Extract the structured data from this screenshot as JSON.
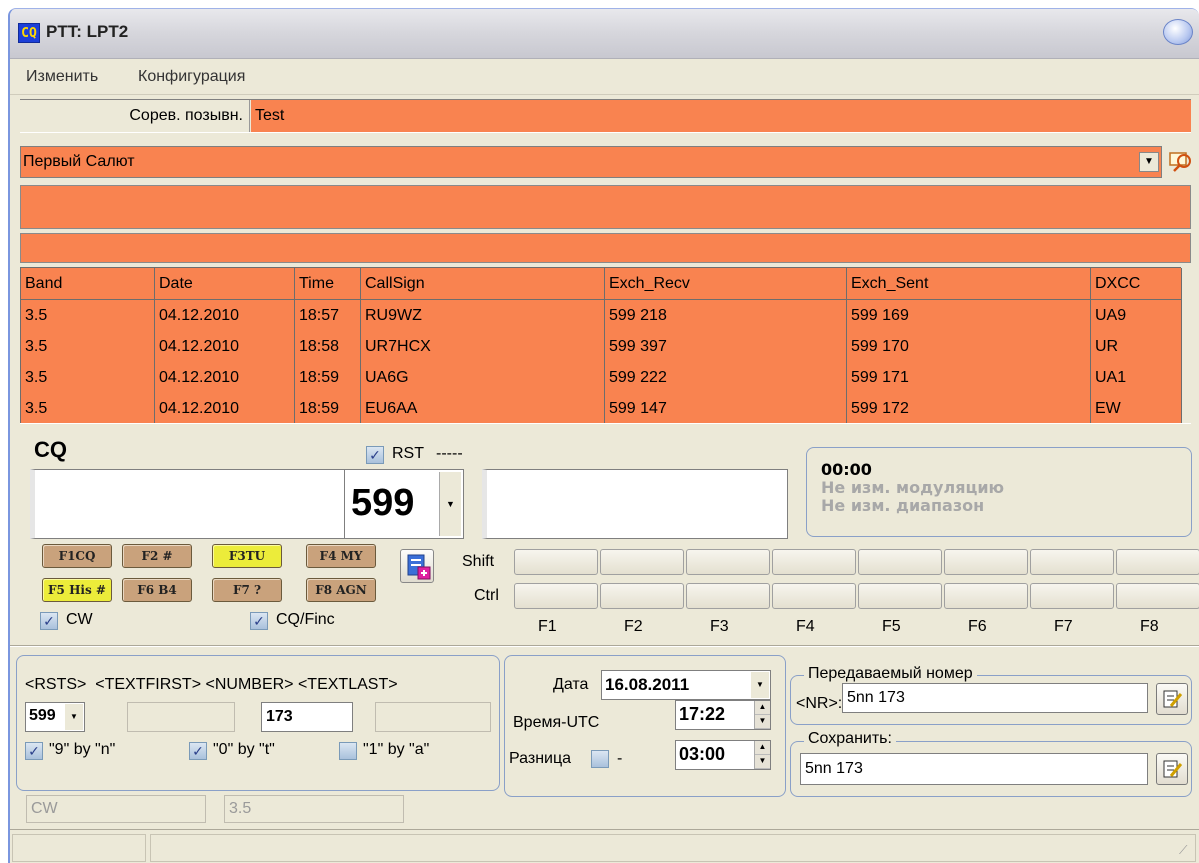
{
  "window": {
    "app_icon_text": "CQ",
    "title": "PTT: LPT2"
  },
  "menu": [
    "Изменить",
    "Конфигурация"
  ],
  "contest_call": {
    "label": "Сорев. позывн.",
    "value": "Test"
  },
  "contest_select": {
    "value": "Первый Салют",
    "search_icon": "search-icon"
  },
  "grid": {
    "columns": [
      "Band",
      "Date",
      "Time",
      "CallSign",
      "Exch_Recv",
      "Exch_Sent",
      "DXCC"
    ],
    "rows": [
      [
        "3.5",
        "04.12.2010",
        "18:57",
        "RU9WZ",
        "599 218",
        "599 169",
        "UA9"
      ],
      [
        "3.5",
        "04.12.2010",
        "18:58",
        "UR7HCX",
        "599 397",
        "599 170",
        "UR"
      ],
      [
        "3.5",
        "04.12.2010",
        "18:59",
        "UA6G",
        "599 222",
        "599 171",
        "UA1"
      ],
      [
        "3.5",
        "04.12.2010",
        "18:59",
        "EU6AA",
        "599 147",
        "599 172",
        "EW"
      ]
    ]
  },
  "entry": {
    "mode_label": "CQ",
    "rst_label": "RST",
    "rst_dashes": "-----",
    "callsign_value": "",
    "rst_value": "599",
    "exchange_value": ""
  },
  "status_panel": {
    "timer": "00:00",
    "line1": "Не изм. модуляцию",
    "line2": "Не изм. диапазон"
  },
  "fkeys": [
    "F1CQ",
    "F2 #",
    "F3TU",
    "F4 MY",
    "F5 His #",
    "F6 B4",
    "F7 ?",
    "F8 AGN"
  ],
  "shift_label": "Shift",
  "ctrl_label": "Ctrl",
  "fn_labels": [
    "F1",
    "F2",
    "F3",
    "F4",
    "F5",
    "F6",
    "F7",
    "F8"
  ],
  "checks": {
    "cw": "CW",
    "cq_finc": "CQ/Finc"
  },
  "format": {
    "headers": "<RSTS>  <TEXTFIRST> <NUMBER> <TEXTLAST>",
    "rsts_value": "599",
    "textfirst_value": "",
    "number_value": "173",
    "textlast_value": "",
    "opt1": "\"9\" by \"n\"",
    "opt2": "\"0\" by \"t\"",
    "opt3": "\"1\" by \"a\""
  },
  "datetime": {
    "date_label": "Дата",
    "date_value": "16.08.2011",
    "utc_label": "Время-UTC",
    "utc_value": "17:22",
    "diff_label": "Разница",
    "diff_sign": "-",
    "diff_value": "03:00"
  },
  "sent_number": {
    "group_label": "Передаваемый номер",
    "nr_label": "<NR>:",
    "nr_value": "5nn 173"
  },
  "save": {
    "group_label": "Сохранить:",
    "value": "5nn 173"
  },
  "bottom": {
    "mode": "CW",
    "band": "3.5"
  }
}
